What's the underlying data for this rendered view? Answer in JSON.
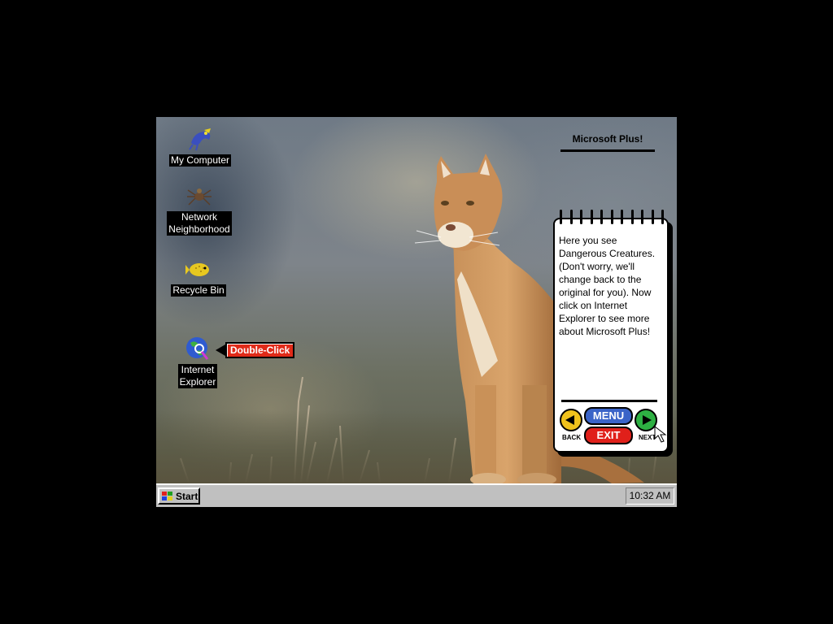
{
  "desktop": {
    "icons": [
      {
        "label": "My Computer"
      },
      {
        "label": "Network\nNeighborhood"
      },
      {
        "label": "Recycle Bin"
      },
      {
        "label": "Internet\nExplorer"
      }
    ],
    "callout": "Double-Click"
  },
  "plus_panel": {
    "title": "Microsoft Plus!",
    "notepad_text": "Here you see Dangerous Creatures.  (Don't worry, we'll change back to the original for you).  Now click on Internet Explorer to see more about Microsoft Plus!",
    "menu_label": "MENU",
    "exit_label": "EXIT",
    "back_label": "BACK",
    "next_label": "NEXT",
    "colors": {
      "back": "#f0c21c",
      "next": "#2eb043",
      "menu": "#3a64c8",
      "exit": "#e0201a"
    }
  },
  "taskbar": {
    "start_label": "Start",
    "clock": "10:32 AM"
  }
}
